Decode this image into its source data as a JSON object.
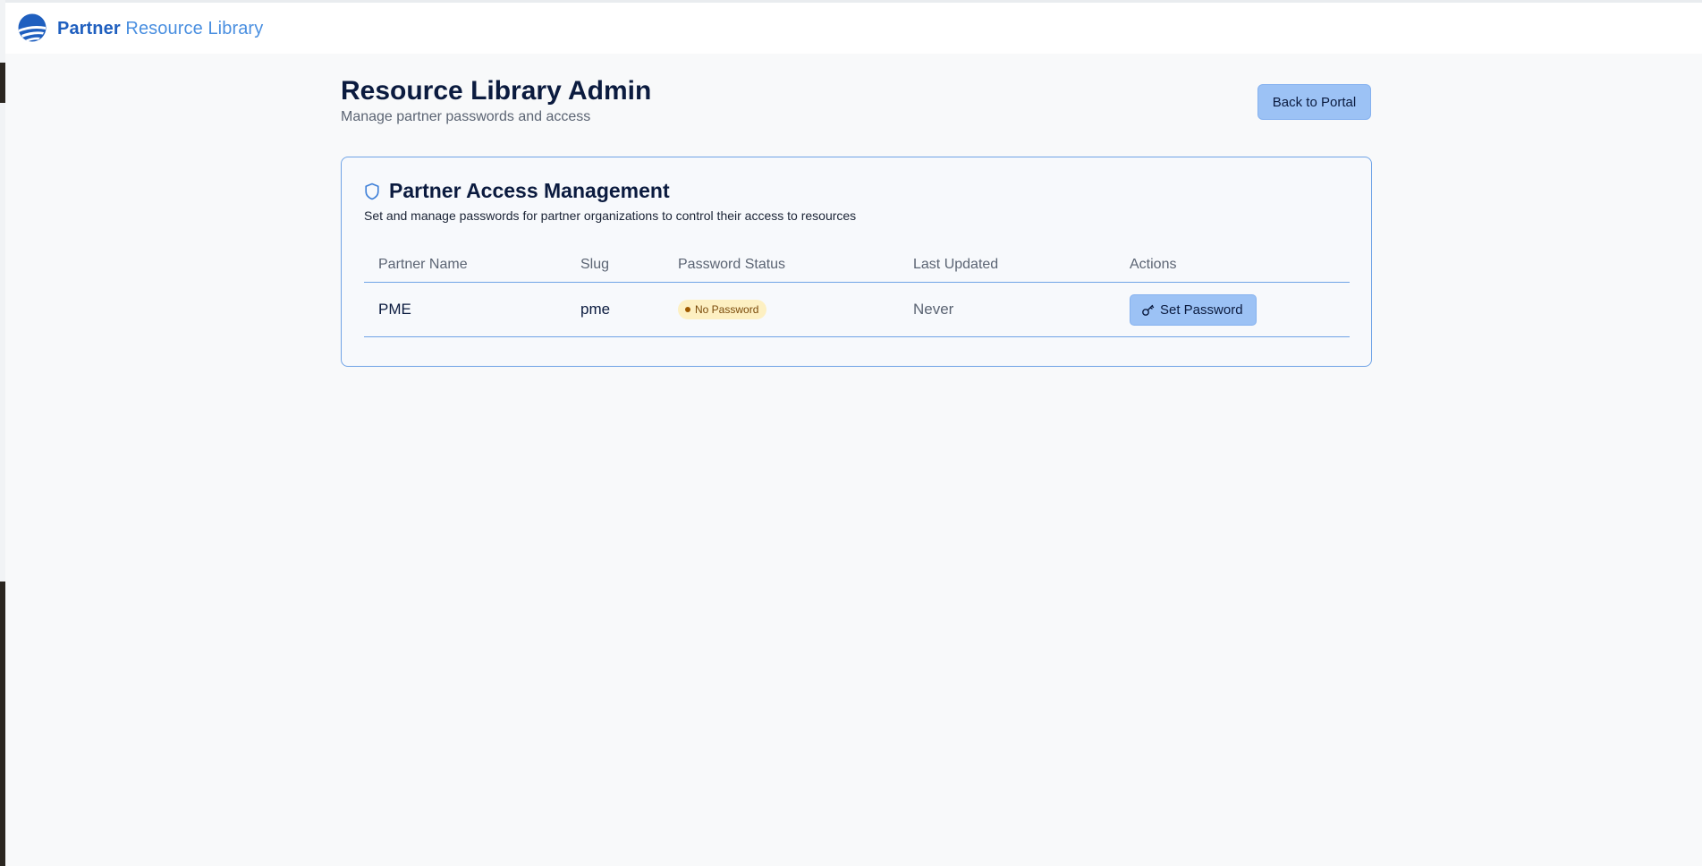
{
  "brand": {
    "word1": "Partner",
    "word2": "Resource Library",
    "logo_icon": "sunrise-logo-icon"
  },
  "header": {
    "title": "Resource Library Admin",
    "subtitle": "Manage partner passwords and access",
    "back_button": "Back to Portal"
  },
  "card": {
    "icon": "shield-icon",
    "title": "Partner Access Management",
    "description": "Set and manage passwords for partner organizations to control their access to resources"
  },
  "table": {
    "columns": [
      "Partner Name",
      "Slug",
      "Password Status",
      "Last Updated",
      "Actions"
    ],
    "rows": [
      {
        "name": "PME",
        "slug": "pme",
        "status": "No Password",
        "last_updated": "Never",
        "action": "Set Password",
        "action_icon": "key-icon"
      }
    ]
  },
  "colors": {
    "accent": "#1f5fbf",
    "button_bg": "#9cc2f5",
    "border": "#6fa3e6",
    "badge_bg": "#fdf0c2",
    "badge_text": "#7a4a0a"
  }
}
